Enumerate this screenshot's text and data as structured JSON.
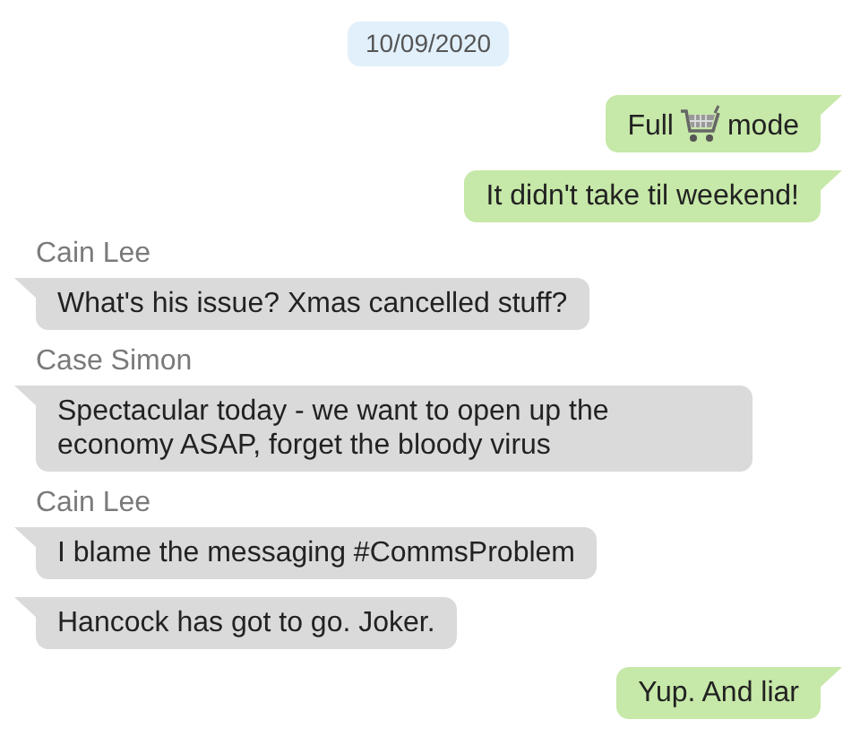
{
  "date": "10/09/2020",
  "messages": [
    {
      "kind": "out",
      "text": "Full",
      "text_after": "mode"
    },
    {
      "kind": "out",
      "text": "It didn't take til weekend!"
    },
    {
      "kind": "in",
      "sender": "Cain Lee",
      "text": "What's his issue? Xmas cancelled stuff?"
    },
    {
      "kind": "in",
      "sender": "Case Simon",
      "text": "Spectacular today - we want to open up the economy ASAP, forget the bloody virus"
    },
    {
      "kind": "in",
      "sender": "Cain Lee",
      "text": "I blame the messaging #CommsProblem"
    },
    {
      "kind": "in",
      "text": "Hancock has got to go. Joker."
    },
    {
      "kind": "out",
      "text": "Yup. And liar"
    }
  ]
}
